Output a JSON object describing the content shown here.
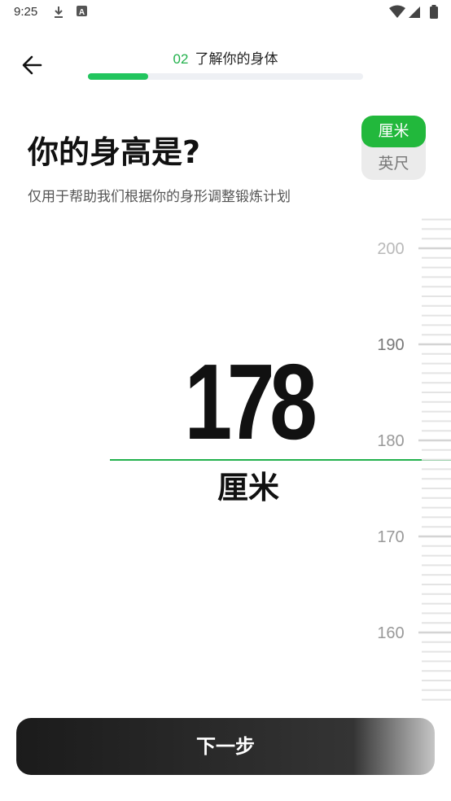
{
  "status_bar": {
    "time": "9:25",
    "icons": [
      "download-icon",
      "font-a-icon",
      "wifi-icon",
      "signal-icon",
      "battery-icon"
    ]
  },
  "header": {
    "step_number": "02",
    "step_title": "了解你的身体",
    "progress": 0.22,
    "back_icon": "arrow-left-icon"
  },
  "question": {
    "title": "你的身高是?",
    "subtitle": "仅用于帮助我们根据你的身形调整锻炼计划"
  },
  "unit_toggle": {
    "selected": "厘米",
    "other": "英尺"
  },
  "height": {
    "value": "178",
    "unit": "厘米"
  },
  "ruler": {
    "major_labels": [
      "200",
      "190",
      "180",
      "170",
      "160"
    ],
    "major_step": 10,
    "minor_per_major": 10
  },
  "footer": {
    "next_label": "下一步"
  },
  "colors": {
    "accent": "#22b14c",
    "button_bg": "#222222",
    "toggle_active": "#22b83c",
    "toggle_bg": "#ebebeb"
  }
}
